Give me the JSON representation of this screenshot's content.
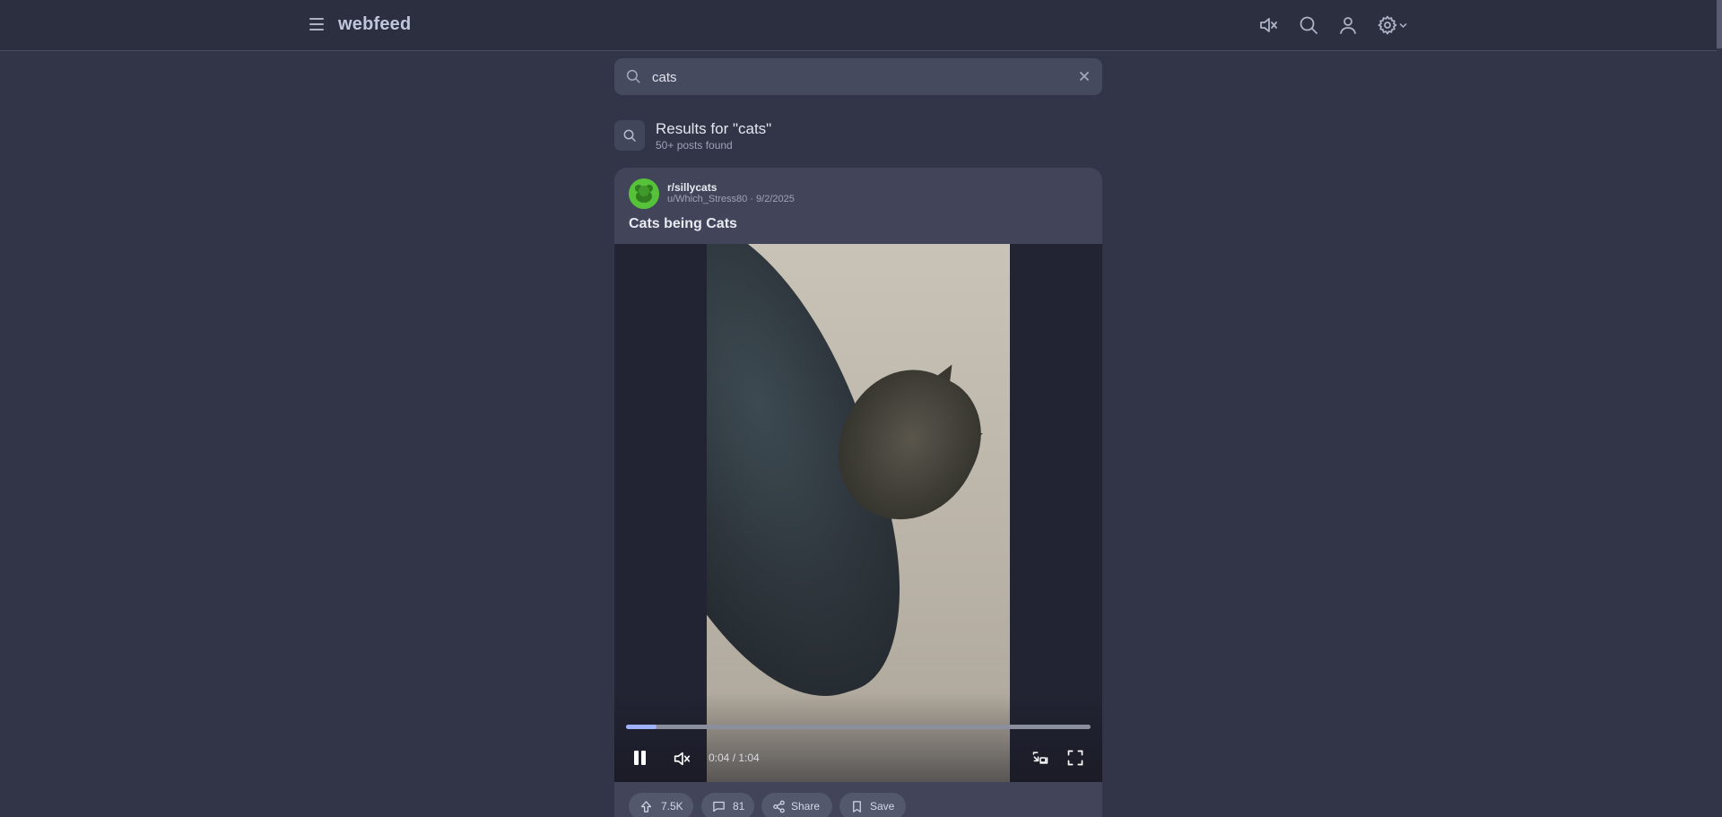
{
  "app": {
    "logo": "webfeed"
  },
  "search": {
    "value": "cats",
    "placeholder": ""
  },
  "results": {
    "title": "Results for \"cats\"",
    "count_text": "50+ posts found"
  },
  "post": {
    "subreddit": "r/sillycats",
    "byline": "u/Which_Stress80 · 9/2/2025",
    "title": "Cats being Cats",
    "video": {
      "time": "0:04 / 1:04",
      "progress_fraction": 0.065
    },
    "actions": {
      "upvotes": "7.5K",
      "comments": "81",
      "share": "Share",
      "save": "Save"
    }
  },
  "colors": {
    "background": "#323547",
    "topbar": "#2c2f40",
    "card": "#42455a",
    "accent": "#9fb3ff",
    "avatar": "#55c23a"
  },
  "icons": [
    "menu-icon",
    "mute-icon",
    "search-icon",
    "user-icon",
    "gear-icon",
    "chevron-down-icon",
    "close-icon",
    "pause-icon",
    "pip-icon",
    "fullscreen-icon",
    "upvote-icon",
    "comment-icon",
    "share-icon",
    "bookmark-icon"
  ]
}
